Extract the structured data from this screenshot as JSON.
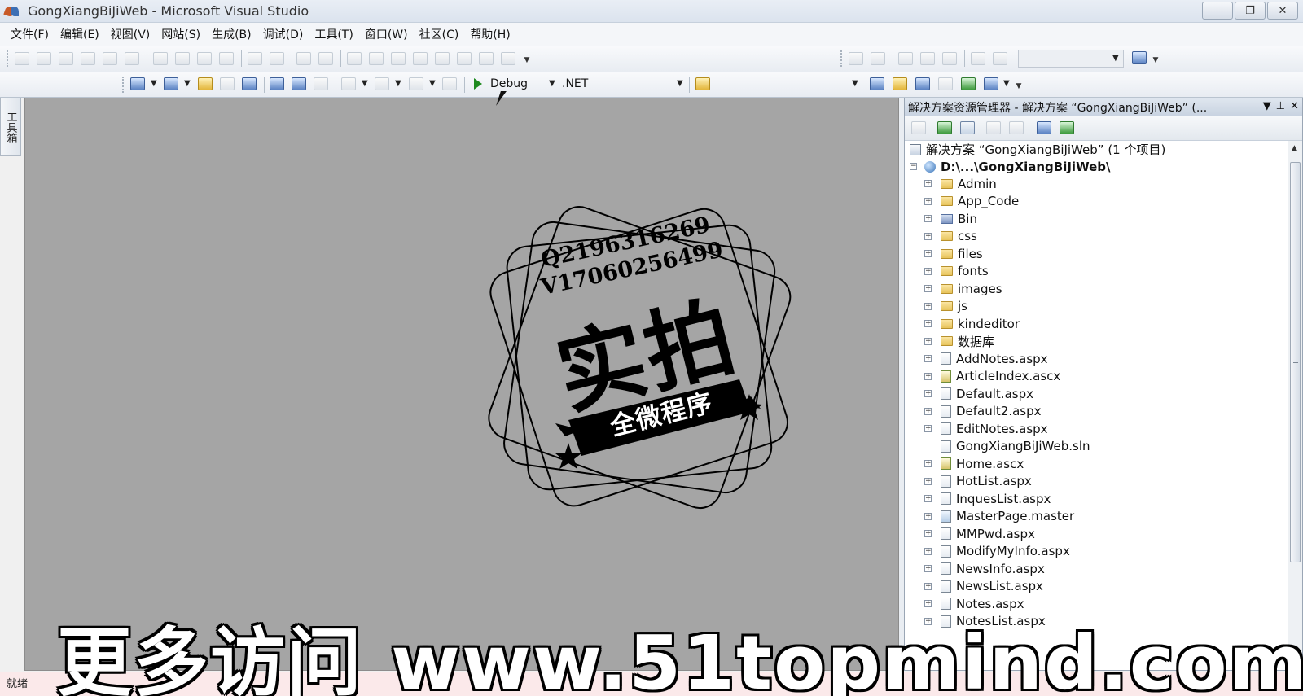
{
  "window": {
    "title": "GongXiangBiJiWeb - Microsoft Visual Studio",
    "controls": [
      "—",
      "❐",
      "✕"
    ]
  },
  "menu": [
    "文件(F)",
    "编辑(E)",
    "视图(V)",
    "网站(S)",
    "生成(B)",
    "调试(D)",
    "工具(T)",
    "窗口(W)",
    "社区(C)",
    "帮助(H)"
  ],
  "toolbar": {
    "config": "Debug",
    "platform": ".NET"
  },
  "toolbox": {
    "label": "工具箱"
  },
  "watermark": {
    "line1": "Q2196316269",
    "line2": "V17060256499",
    "big": "实拍",
    "ribbon": "全微程序"
  },
  "solution_explorer": {
    "title": "解决方案资源管理器 - 解决方案 “GongXiangBiJiWeb” (...",
    "header_buttons": [
      "▼",
      "📌",
      "✕"
    ],
    "solution_node": "解决方案 “GongXiangBiJiWeb” (1 个项目)",
    "project_node": "D:\\...\\GongXiangBiJiWeb\\",
    "items": [
      {
        "name": "Admin",
        "icon": "folder-icon"
      },
      {
        "name": "App_Code",
        "icon": "code-folder-icon"
      },
      {
        "name": "Bin",
        "icon": "bin-folder-icon"
      },
      {
        "name": "css",
        "icon": "folder-icon"
      },
      {
        "name": "files",
        "icon": "folder-icon"
      },
      {
        "name": "fonts",
        "icon": "folder-icon"
      },
      {
        "name": "images",
        "icon": "folder-icon"
      },
      {
        "name": "js",
        "icon": "folder-icon"
      },
      {
        "name": "kindeditor",
        "icon": "folder-icon"
      },
      {
        "name": "数据库",
        "icon": "folder-icon"
      },
      {
        "name": "AddNotes.aspx",
        "icon": "aspx-file-icon"
      },
      {
        "name": "ArticleIndex.ascx",
        "icon": "ascx-file-icon"
      },
      {
        "name": "Default.aspx",
        "icon": "aspx-file-icon"
      },
      {
        "name": "Default2.aspx",
        "icon": "aspx-file-icon"
      },
      {
        "name": "EditNotes.aspx",
        "icon": "aspx-file-icon"
      },
      {
        "name": "GongXiangBiJiWeb.sln",
        "icon": "sln-file-icon"
      },
      {
        "name": "Home.ascx",
        "icon": "ascx-file-icon"
      },
      {
        "name": "HotList.aspx",
        "icon": "aspx-file-icon"
      },
      {
        "name": "InquesList.aspx",
        "icon": "aspx-file-icon"
      },
      {
        "name": "MasterPage.master",
        "icon": "master-file-icon"
      },
      {
        "name": "MMPwd.aspx",
        "icon": "aspx-file-icon"
      },
      {
        "name": "ModifyMyInfo.aspx",
        "icon": "aspx-file-icon"
      },
      {
        "name": "NewsInfo.aspx",
        "icon": "aspx-file-icon"
      },
      {
        "name": "NewsList.aspx",
        "icon": "aspx-file-icon"
      },
      {
        "name": "Notes.aspx",
        "icon": "aspx-file-icon"
      },
      {
        "name": "NotesList.aspx",
        "icon": "aspx-file-icon"
      }
    ]
  },
  "status": {
    "text": "就绪"
  },
  "overlay": {
    "text": "更多访问 www.51topmind.com"
  }
}
